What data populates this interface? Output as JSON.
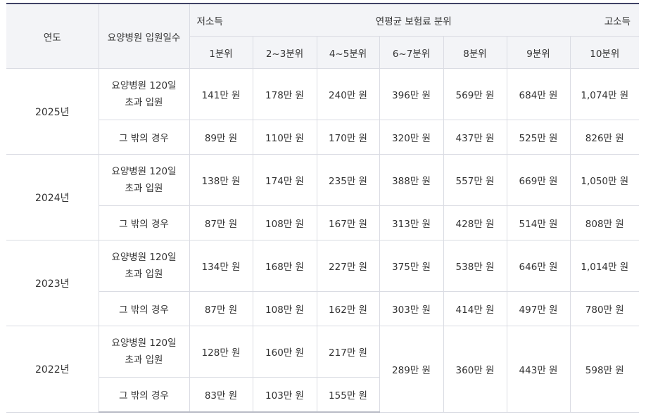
{
  "header": {
    "year": "연도",
    "stay_days": "요양병원 입원일수",
    "low_income": "저소득",
    "quantile_title": "연평균 보험료 분위",
    "high_income": "고소득",
    "quantiles": [
      "1분위",
      "2~3분위",
      "4~5분위",
      "6~7분위",
      "8분위",
      "9분위",
      "10분위"
    ]
  },
  "labels": {
    "over_120_line1": "요양병원 120일",
    "over_120_line2": "초과 입원",
    "other": "그 밖의 경우"
  },
  "rows": [
    {
      "year": "2025년",
      "over120": [
        "141만 원",
        "178만 원",
        "240만 원",
        "396만 원",
        "569만 원",
        "684만 원",
        "1,074만 원"
      ],
      "other": [
        "89만 원",
        "110만 원",
        "170만 원",
        "320만 원",
        "437만 원",
        "525만 원",
        "826만 원"
      ]
    },
    {
      "year": "2024년",
      "over120": [
        "138만 원",
        "174만 원",
        "235만 원",
        "388만 원",
        "557만 원",
        "669만 원",
        "1,050만 원"
      ],
      "other": [
        "87만 원",
        "108만 원",
        "167만 원",
        "313만 원",
        "428만 원",
        "514만 원",
        "808만 원"
      ]
    },
    {
      "year": "2023년",
      "over120": [
        "134만 원",
        "168만 원",
        "227만 원",
        "375만 원",
        "538만 원",
        "646만 원",
        "1,014만 원"
      ],
      "other": [
        "87만 원",
        "108만 원",
        "162만 원",
        "303만 원",
        "414만 원",
        "497만 원",
        "780만 원"
      ]
    },
    {
      "year": "2022년",
      "over120": [
        "128만 원",
        "160만 원",
        "217만 원"
      ],
      "other": [
        "83만 원",
        "103만 원",
        "155만 원"
      ],
      "shared": [
        "289만 원",
        "360만 원",
        "443만 원",
        "598만 원"
      ]
    }
  ]
}
